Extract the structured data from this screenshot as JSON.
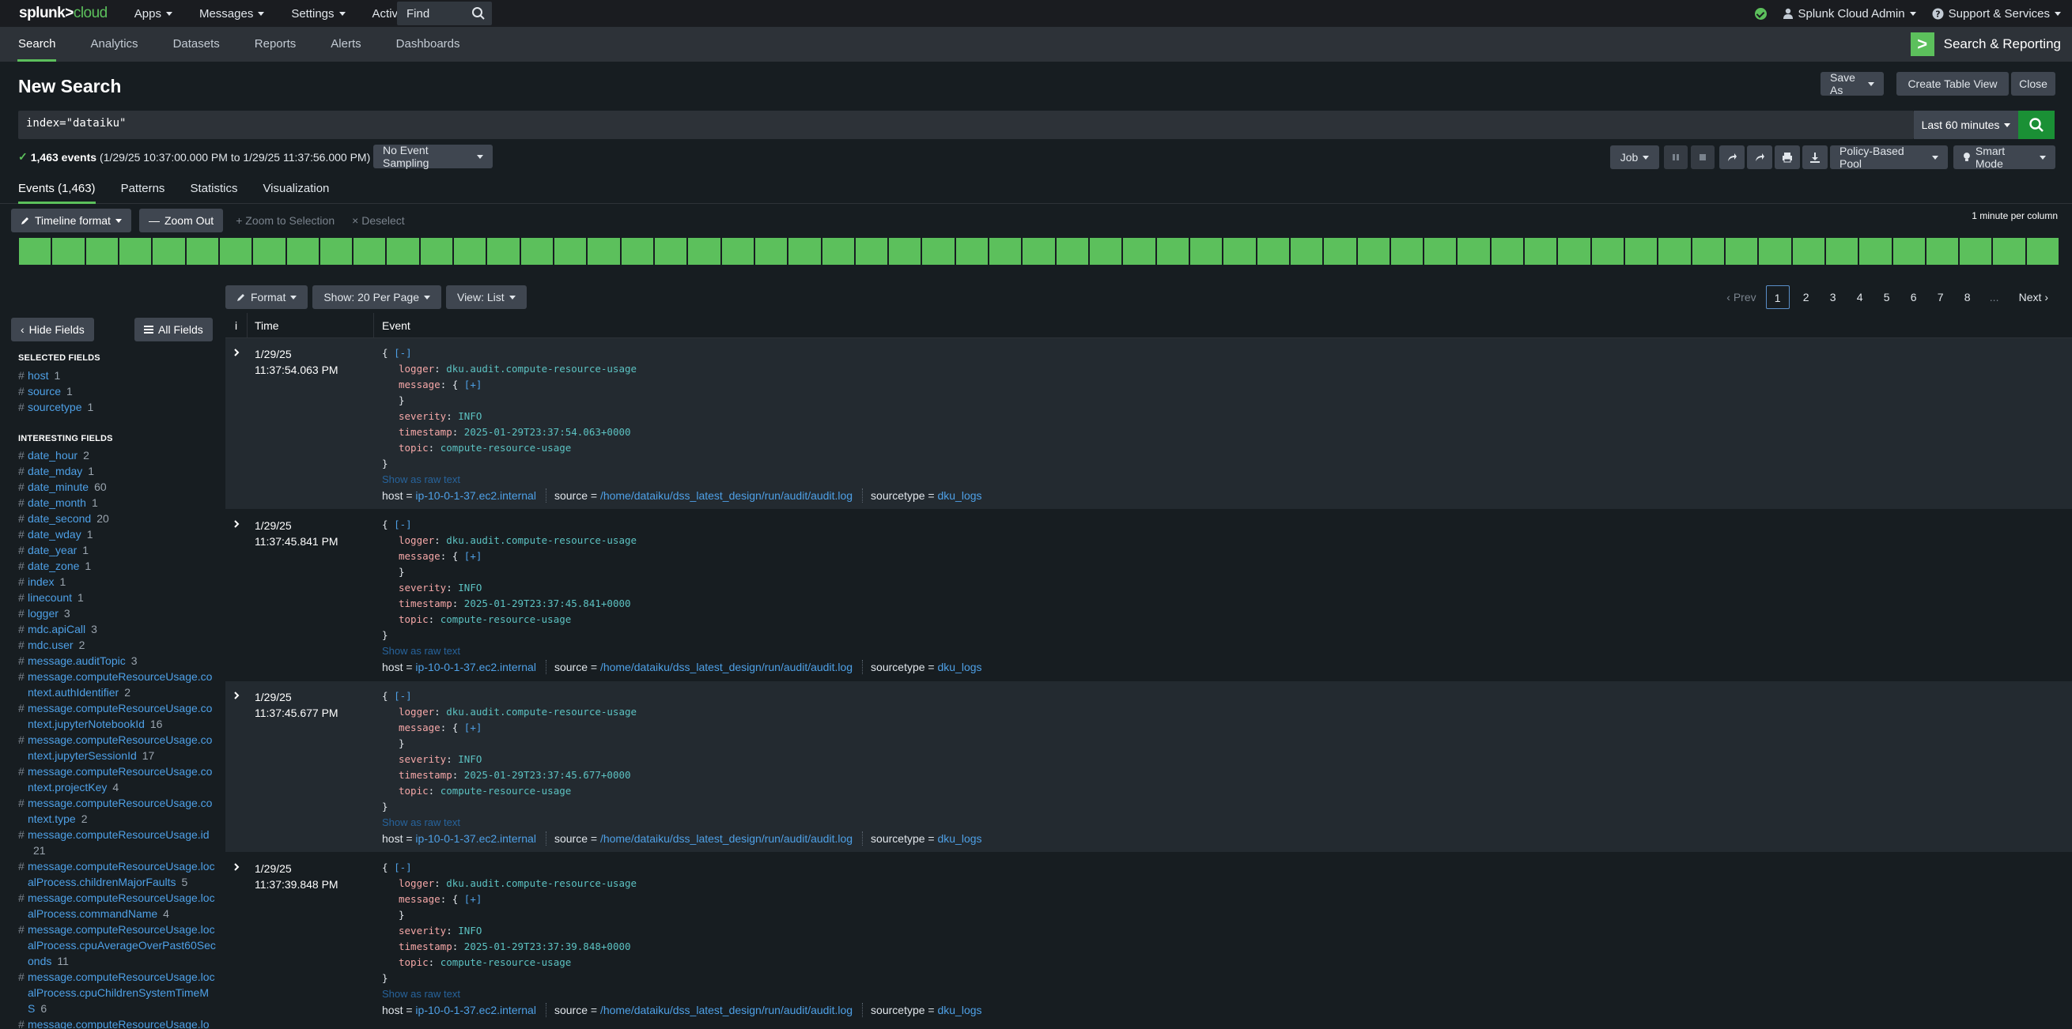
{
  "top": {
    "logo_a": "splunk>",
    "logo_b": "cloud",
    "menus": [
      "Apps",
      "Messages",
      "Settings",
      "Activity"
    ],
    "find_label": "Find",
    "user": "Splunk Cloud Admin",
    "support": "Support & Services"
  },
  "appnav": {
    "items": [
      "Search",
      "Analytics",
      "Datasets",
      "Reports",
      "Alerts",
      "Dashboards"
    ],
    "app_name": "Search & Reporting",
    "app_logo": ">"
  },
  "page": {
    "title": "New Search",
    "save_as": "Save As",
    "create_table_view": "Create Table View",
    "close": "Close"
  },
  "search": {
    "query": "index=\"dataiku\"",
    "time_range": "Last 60 minutes"
  },
  "status": {
    "count": "1,463 events",
    "range": "(1/29/25 10:37:00.000 PM to 1/29/25 11:37:56.000 PM)",
    "sampling": "No Event Sampling",
    "job": "Job",
    "pool": "Policy-Based Pool",
    "mode": "Smart Mode"
  },
  "tabs": [
    "Events (1,463)",
    "Patterns",
    "Statistics",
    "Visualization"
  ],
  "timeline": {
    "format": "Timeline format",
    "zoom_out": "Zoom Out",
    "zoom_sel": "Zoom to Selection",
    "deselect": "Deselect",
    "scale": "1 minute per column",
    "buckets": 61
  },
  "results": {
    "format": "Format",
    "per_page": "Show: 20 Per Page",
    "view": "View: List",
    "prev": "Prev",
    "pages": [
      "1",
      "2",
      "3",
      "4",
      "5",
      "6",
      "7",
      "8"
    ],
    "ellipsis": "...",
    "next": "Next"
  },
  "sidebar": {
    "hide_fields": "Hide Fields",
    "all_fields": "All Fields",
    "selected_heading": "SELECTED FIELDS",
    "interesting_heading": "INTERESTING FIELDS",
    "selected": [
      {
        "name": "host",
        "count": "1"
      },
      {
        "name": "source",
        "count": "1"
      },
      {
        "name": "sourcetype",
        "count": "1"
      }
    ],
    "interesting": [
      {
        "name": "date_hour",
        "count": "2"
      },
      {
        "name": "date_mday",
        "count": "1"
      },
      {
        "name": "date_minute",
        "count": "60"
      },
      {
        "name": "date_month",
        "count": "1"
      },
      {
        "name": "date_second",
        "count": "20"
      },
      {
        "name": "date_wday",
        "count": "1"
      },
      {
        "name": "date_year",
        "count": "1"
      },
      {
        "name": "date_zone",
        "count": "1"
      },
      {
        "name": "index",
        "count": "1"
      },
      {
        "name": "linecount",
        "count": "1"
      },
      {
        "name": "logger",
        "count": "3"
      },
      {
        "name": "mdc.apiCall",
        "count": "3"
      },
      {
        "name": "mdc.user",
        "count": "2"
      },
      {
        "name": "message.auditTopic",
        "count": "3"
      },
      {
        "name": "message.computeResourceUsage.context.authIdentifier",
        "count": "2"
      },
      {
        "name": "message.computeResourceUsage.context.jupyterNotebookId",
        "count": "16"
      },
      {
        "name": "message.computeResourceUsage.context.jupyterSessionId",
        "count": "17"
      },
      {
        "name": "message.computeResourceUsage.context.projectKey",
        "count": "4"
      },
      {
        "name": "message.computeResourceUsage.context.type",
        "count": "2"
      },
      {
        "name": "message.computeResourceUsage.id",
        "count": "21"
      },
      {
        "name": "message.computeResourceUsage.localProcess.childrenMajorFaults",
        "count": "5"
      },
      {
        "name": "message.computeResourceUsage.localProcess.commandName",
        "count": "4"
      },
      {
        "name": "message.computeResourceUsage.localProcess.cpuAverageOverPast60Seconds",
        "count": "11"
      },
      {
        "name": "message.computeResourceUsage.localProcess.cpuChildrenSystemTimeMS",
        "count": "6"
      },
      {
        "name": "message.computeResourceUsage.lo",
        "count": ""
      }
    ]
  },
  "table": {
    "col_info": "i",
    "col_time": "Time",
    "col_event": "Event",
    "raw_link": "Show as raw text",
    "collapse": "[-]",
    "expand": "[+]",
    "events": [
      {
        "date": "1/29/25",
        "time": "11:37:54.063 PM",
        "logger": "dku.audit.compute-resource-usage",
        "severity": "INFO",
        "timestamp": "2025-01-29T23:37:54.063+0000",
        "topic": "compute-resource-usage",
        "host": "ip-10-0-1-37.ec2.internal",
        "source": "/home/dataiku/dss_latest_design/run/audit/audit.log",
        "sourcetype": "dku_logs"
      },
      {
        "date": "1/29/25",
        "time": "11:37:45.841 PM",
        "logger": "dku.audit.compute-resource-usage",
        "severity": "INFO",
        "timestamp": "2025-01-29T23:37:45.841+0000",
        "topic": "compute-resource-usage",
        "host": "ip-10-0-1-37.ec2.internal",
        "source": "/home/dataiku/dss_latest_design/run/audit/audit.log",
        "sourcetype": "dku_logs"
      },
      {
        "date": "1/29/25",
        "time": "11:37:45.677 PM",
        "logger": "dku.audit.compute-resource-usage",
        "severity": "INFO",
        "timestamp": "2025-01-29T23:37:45.677+0000",
        "topic": "compute-resource-usage",
        "host": "ip-10-0-1-37.ec2.internal",
        "source": "/home/dataiku/dss_latest_design/run/audit/audit.log",
        "sourcetype": "dku_logs"
      },
      {
        "date": "1/29/25",
        "time": "11:37:39.848 PM",
        "logger": "dku.audit.compute-resource-usage",
        "severity": "INFO",
        "timestamp": "2025-01-29T23:37:39.848+0000",
        "topic": "compute-resource-usage",
        "host": "ip-10-0-1-37.ec2.internal",
        "source": "/home/dataiku/dss_latest_design/run/audit/audit.log",
        "sourcetype": "dku_logs"
      }
    ]
  },
  "colors": {
    "accent": "#5cc05c",
    "link": "#4ea0e6",
    "search_btn": "#1a9035"
  }
}
